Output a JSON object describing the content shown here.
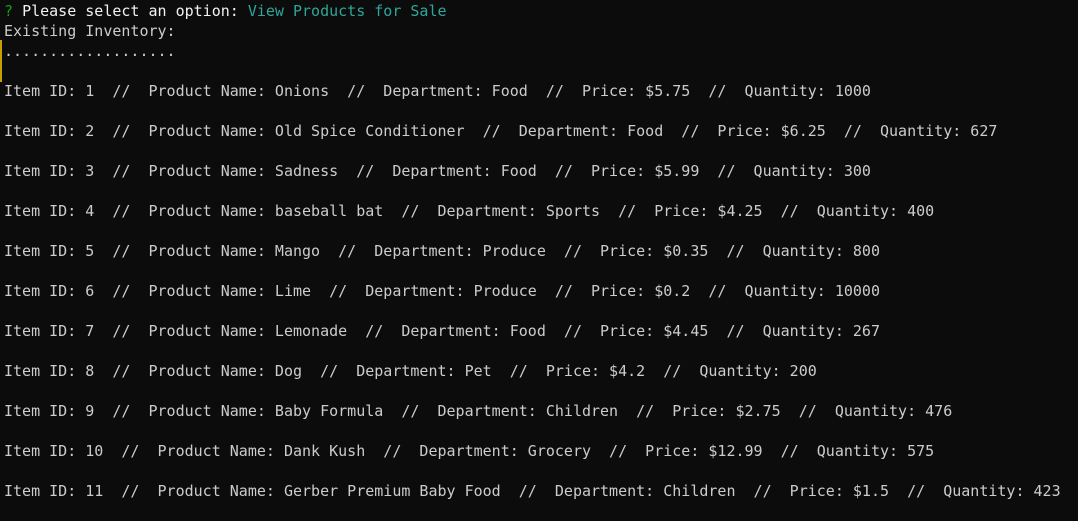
{
  "prompt": {
    "mark": "?",
    "question": "Please select an option:",
    "answer": "View Products for Sale"
  },
  "heading": "Existing Inventory:",
  "separator": "...................",
  "rows": [
    "Item ID: 1  //  Product Name: Onions  //  Department: Food  //  Price: $5.75  //  Quantity: 1000",
    "Item ID: 2  //  Product Name: Old Spice Conditioner  //  Department: Food  //  Price: $6.25  //  Quantity: 627",
    "Item ID: 3  //  Product Name: Sadness  //  Department: Food  //  Price: $5.99  //  Quantity: 300",
    "Item ID: 4  //  Product Name: baseball bat  //  Department: Sports  //  Price: $4.25  //  Quantity: 400",
    "Item ID: 5  //  Product Name: Mango  //  Department: Produce  //  Price: $0.35  //  Quantity: 800",
    "Item ID: 6  //  Product Name: Lime  //  Department: Produce  //  Price: $0.2  //  Quantity: 10000",
    "Item ID: 7  //  Product Name: Lemonade  //  Department: Food  //  Price: $4.45  //  Quantity: 267",
    "Item ID: 8  //  Product Name: Dog  //  Department: Pet  //  Price: $4.2  //  Quantity: 200",
    "Item ID: 9  //  Product Name: Baby Formula  //  Department: Children  //  Price: $2.75  //  Quantity: 476",
    "Item ID: 10  //  Product Name: Dank Kush  //  Department: Grocery  //  Price: $12.99  //  Quantity: 575",
    "Item ID: 11  //  Product Name: Gerber Premium Baby Food  //  Department: Children  //  Price: $1.5  //  Quantity: 423"
  ]
}
